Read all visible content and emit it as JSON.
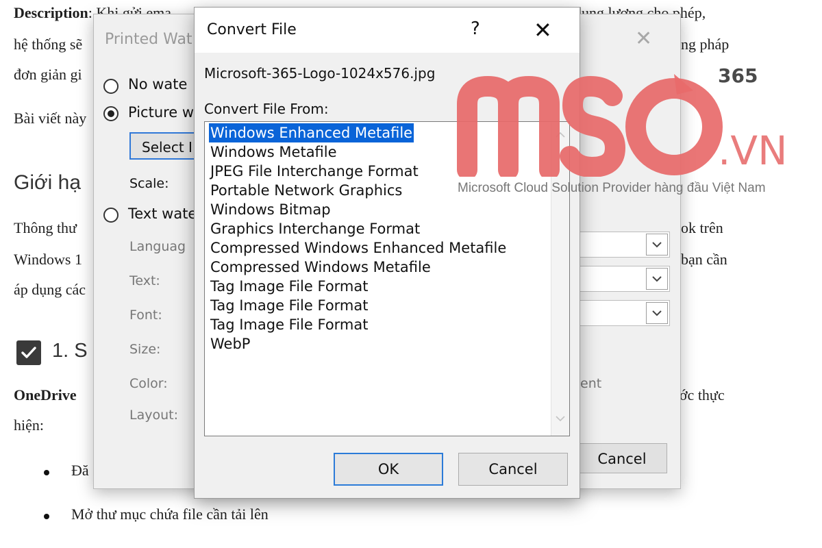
{
  "article": {
    "p1_bold": "Description",
    "p1_rest": ": Khi gửi ema",
    "p1_right": "dung lượng cho phép,",
    "p2_left": "hệ thống sẽ",
    "p2_right": "ng pháp",
    "p3_left": "đơn giản gi",
    "p4_left": "Bài viết này",
    "h2_left": "Giới hạ",
    "p5_left": "Thông thư",
    "p5_right": "ok trên",
    "p6_left": "Windows 1",
    "p6_right": "bạn cần",
    "p7_left": "áp dụng các",
    "h3_left": "1. S",
    "p8_bold": "OneDrive",
    "p8_right": "ước thực",
    "p9_left": "hiện:",
    "bullet1": "Đă",
    "bullet2": "Mở thư mục chứa file cần tải lên"
  },
  "watermark_dialog": {
    "title": "Printed Wat",
    "close_glyph": "✕",
    "opt_no": "No wate",
    "opt_no_key": "N",
    "opt_picture": "Picture w",
    "opt_picture_key": "P",
    "select_btn": "Select I",
    "scale_label": "Scale:",
    "opt_text": "Text wate",
    "language_label": "Languag",
    "text_label": "Text:",
    "font_label": "Font:",
    "size_label": "Size:",
    "color_label": "Color:",
    "layout_label": "Layout:",
    "semi_label": "ent",
    "cancel": "Cancel"
  },
  "convert_dialog": {
    "title": "Convert File",
    "help_glyph": "?",
    "close_glyph": "✕",
    "filename": "Microsoft-365-Logo-1024x576.jpg",
    "convert_from_label": "Convert File From:",
    "formats": [
      "Windows Enhanced Metafile",
      "Windows Metafile",
      "JPEG File Interchange Format",
      "Portable Network Graphics",
      "Windows Bitmap",
      "Graphics Interchange Format",
      "Compressed Windows Enhanced Metafile",
      "Compressed Windows Metafile",
      "Tag Image File Format",
      "Tag Image File Format",
      "Tag Image File Format",
      "WebP"
    ],
    "selected_index": 0,
    "ok": "OK",
    "cancel": "Cancel"
  },
  "logo": {
    "sup": "365",
    "vn": ".VN",
    "tagline": "Microsoft Cloud Solution Provider hàng đầu Việt Nam",
    "color": "#e86a6a"
  },
  "colors": {
    "selection": "#0a64d8",
    "focus_border": "#2b7bd8"
  }
}
